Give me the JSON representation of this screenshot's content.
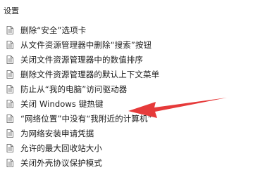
{
  "section": {
    "title": "设置"
  },
  "policies": [
    {
      "label": "删除“安全”选项卡"
    },
    {
      "label": "从文件资源管理器中删除“搜索”按钮"
    },
    {
      "label": "关闭文件资源管理器中的数值排序"
    },
    {
      "label": "删除文件资源管理器的默认上下文菜单"
    },
    {
      "label": "防止从“我的电脑”访问驱动器"
    },
    {
      "label": "关闭 Windows 键热键"
    },
    {
      "label": "“网络位置”中没有“我附近的计算机”"
    },
    {
      "label": "为网络安装申请凭据"
    },
    {
      "label": "允许的最大回收站大小"
    },
    {
      "label": "关闭外壳协议保护模式"
    }
  ],
  "icons": {
    "policy_item": "policy-setting-icon",
    "annotation": "red-arrow-icon"
  },
  "colors": {
    "annotation_arrow": "#e63a3a",
    "icon_stroke": "#5a5a5a"
  }
}
